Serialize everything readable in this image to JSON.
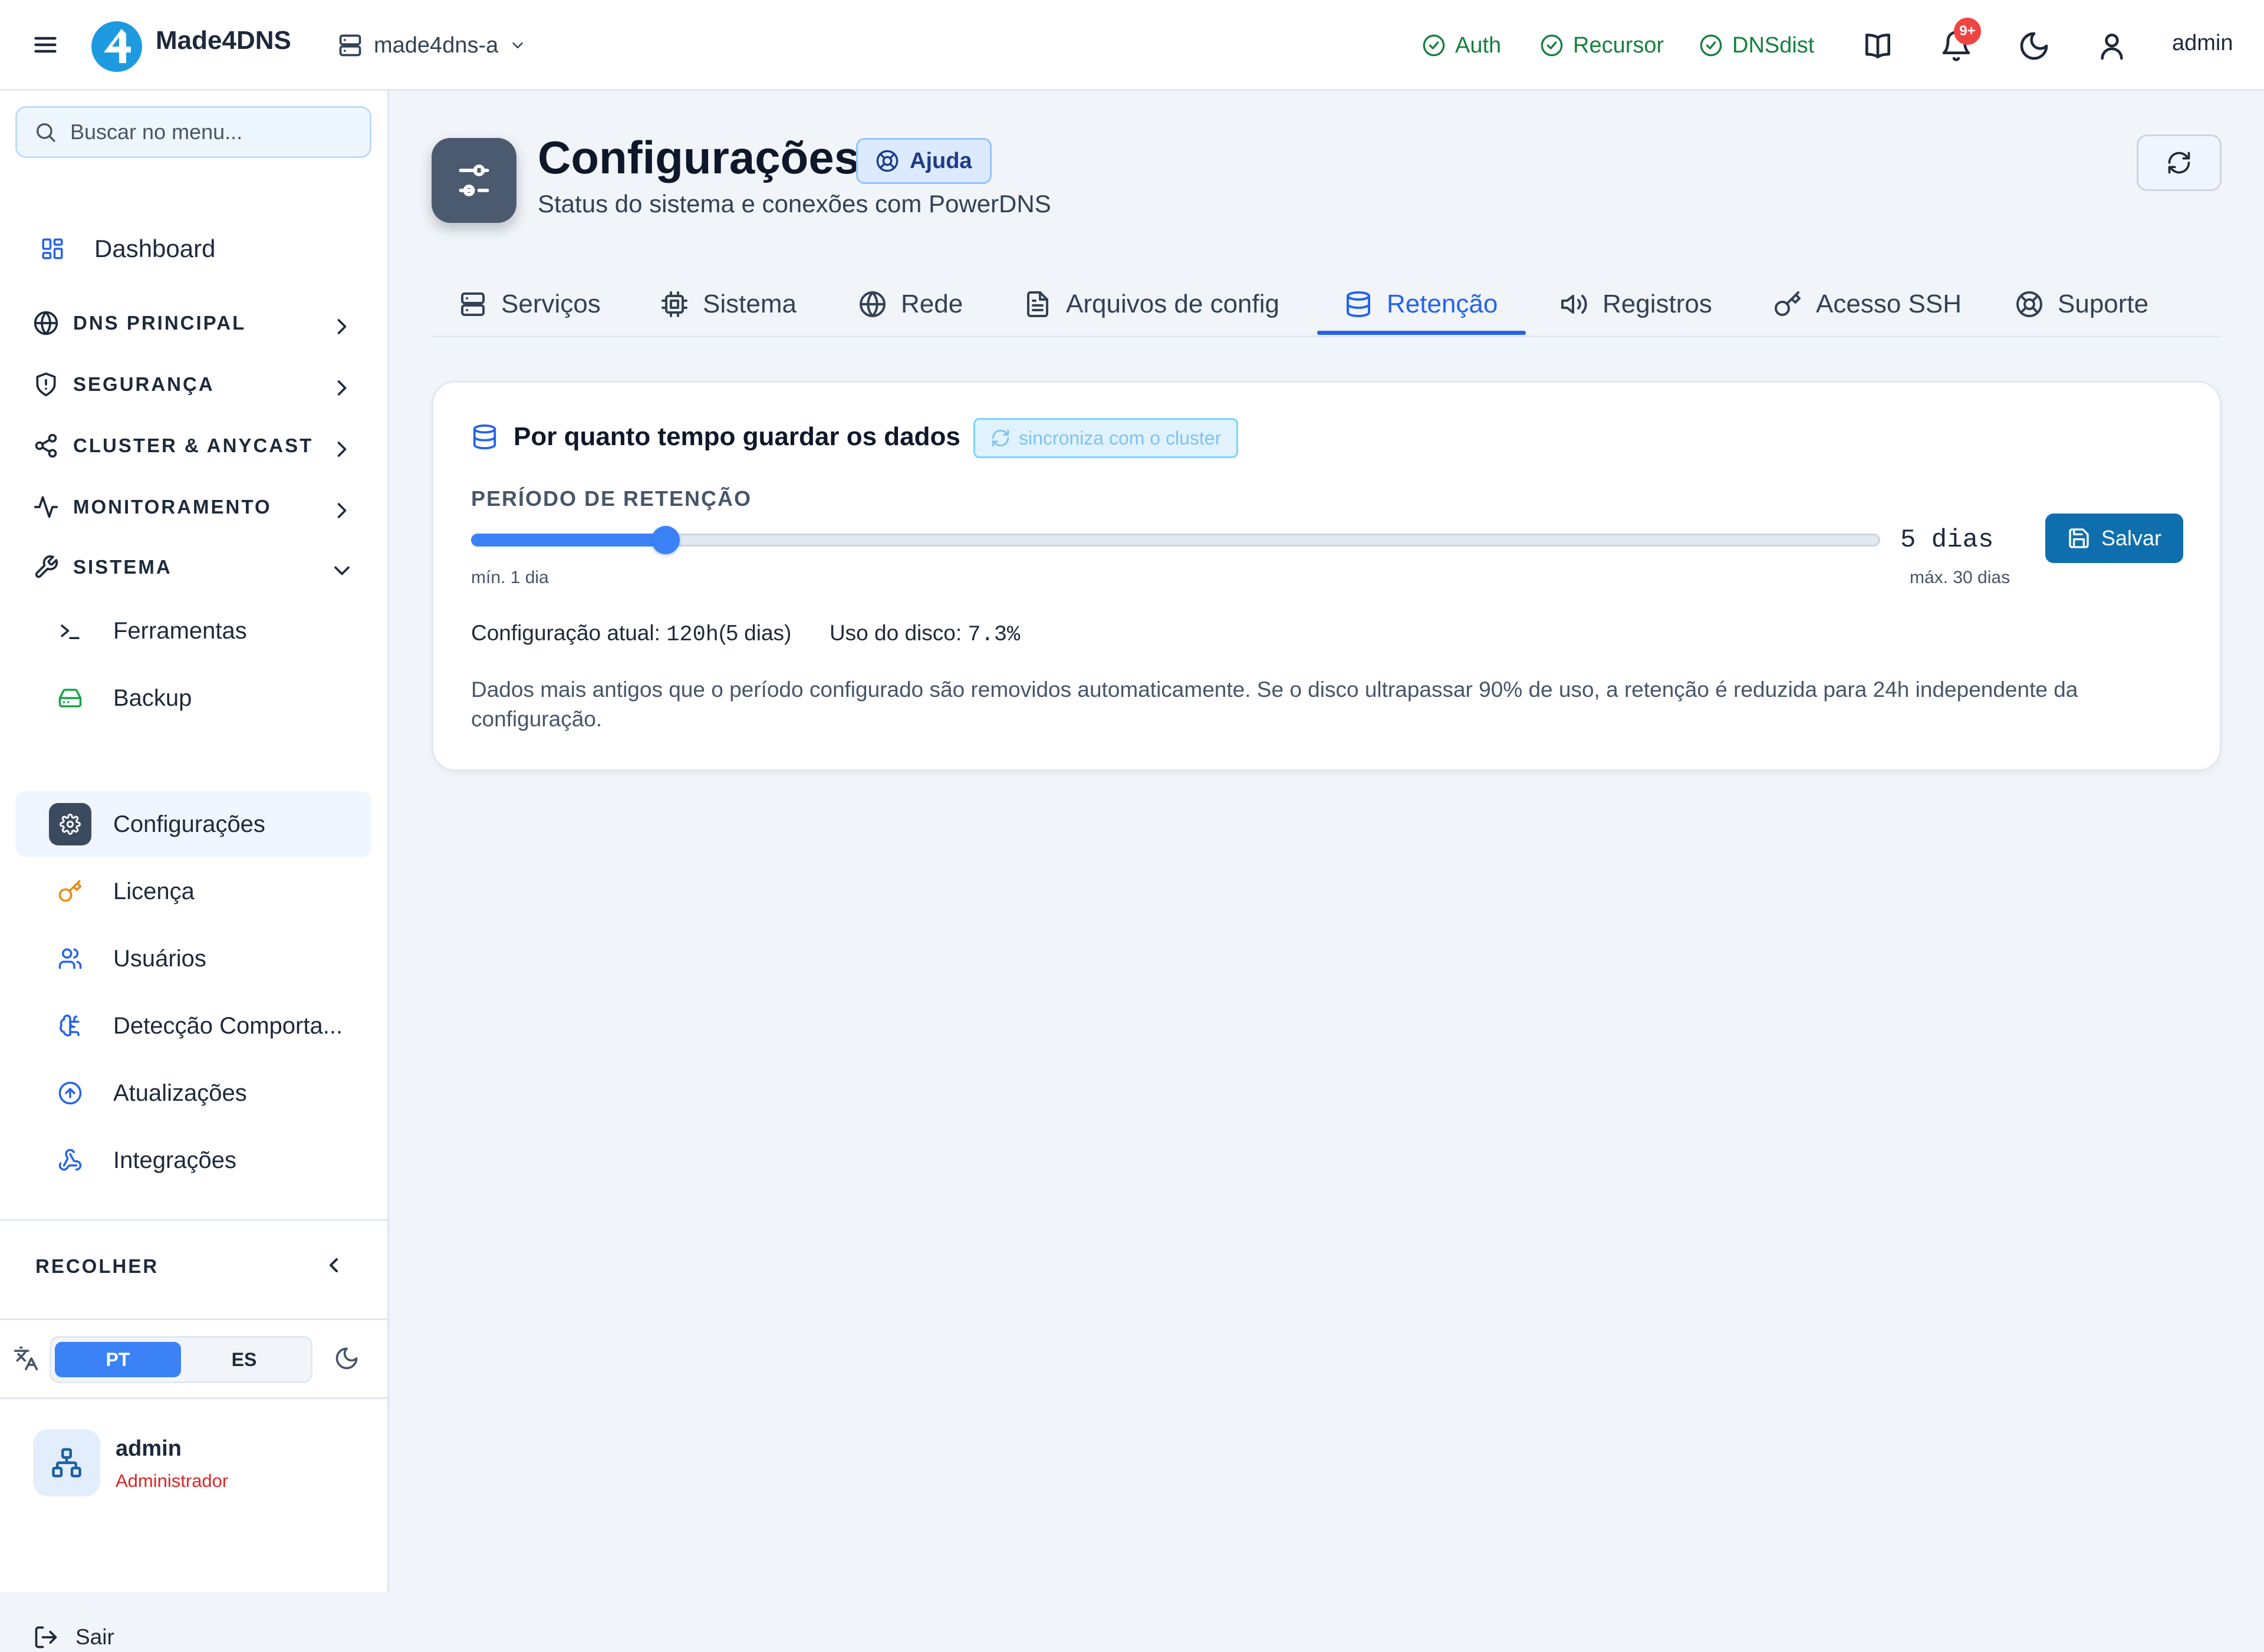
{
  "header": {
    "brand": "Made4DNS",
    "server": "made4dns-a",
    "services": [
      {
        "label": "Auth",
        "status": "ok"
      },
      {
        "label": "Recursor",
        "status": "ok"
      },
      {
        "label": "DNSdist",
        "status": "ok"
      }
    ],
    "notification_badge": "9+",
    "user": "admin",
    "icons": [
      "menu-icon",
      "logo",
      "server-icon",
      "check-circle-icon",
      "book-icon",
      "bell-icon",
      "moon-icon",
      "user-icon"
    ]
  },
  "sidebar": {
    "search_placeholder": "Buscar no menu...",
    "dashboard": "Dashboard",
    "sections": [
      {
        "label": "DNS PRINCIPAL",
        "icon": "globe-icon",
        "expanded": false
      },
      {
        "label": "SEGURANÇA",
        "icon": "shield-icon",
        "expanded": false
      },
      {
        "label": "CLUSTER & ANYCAST",
        "icon": "share-icon",
        "expanded": false
      },
      {
        "label": "MONITORAMENTO",
        "icon": "activity-icon",
        "expanded": false
      },
      {
        "label": "SISTEMA",
        "icon": "wrench-icon",
        "expanded": true
      }
    ],
    "sistema_items": [
      {
        "label": "Ferramentas",
        "icon": "terminal-icon"
      },
      {
        "label": "Backup",
        "icon": "hard-drive-icon"
      },
      {
        "label": "Configurações",
        "icon": "gear-icon",
        "active": true
      },
      {
        "label": "Licença",
        "icon": "key-icon"
      },
      {
        "label": "Usuários",
        "icon": "users-icon"
      },
      {
        "label": "Detecção Comporta...",
        "icon": "brain-icon"
      },
      {
        "label": "Atualizações",
        "icon": "arrow-up-circle-icon"
      },
      {
        "label": "Integrações",
        "icon": "webhook-icon"
      }
    ],
    "collapse_label": "RECOLHER",
    "languages": [
      "PT",
      "ES"
    ],
    "active_language": "PT",
    "user": {
      "name": "admin",
      "role": "Administrador"
    },
    "logout": "Sair"
  },
  "page": {
    "title": "Configurações",
    "help": "Ajuda",
    "subtitle": "Status do sistema e conexões com PowerDNS",
    "tabs": [
      {
        "label": "Serviços",
        "icon": "server-icon"
      },
      {
        "label": "Sistema",
        "icon": "cpu-icon"
      },
      {
        "label": "Rede",
        "icon": "globe-icon"
      },
      {
        "label": "Arquivos de config",
        "icon": "file-text-icon"
      },
      {
        "label": "Retenção",
        "icon": "database-icon",
        "active": true
      },
      {
        "label": "Registros",
        "icon": "megaphone-icon"
      },
      {
        "label": "Acesso SSH",
        "icon": "key-icon"
      },
      {
        "label": "Suporte",
        "icon": "life-buoy-icon"
      }
    ]
  },
  "retention": {
    "card_title": "Por quanto tempo guardar os dados",
    "sync_badge": "sincroniza com o cluster",
    "period_label": "PERÍODO DE RETENÇÃO",
    "min_days": 1,
    "max_days": 30,
    "value_days": 5,
    "value_text": "5 dias",
    "min_label": "mín. 1 dia",
    "max_label": "máx. 30 dias",
    "save": "Salvar",
    "current_label": "Configuração atual:",
    "current_value": "120h",
    "current_days": "(5 dias)",
    "disk_label": "Uso do disco:",
    "disk_value": "7.3%",
    "description": "Dados mais antigos que o período configurado são removidos automaticamente. Se o disco ultrapassar 90% de uso, a retenção é reduzida para 24h independente da configuração."
  },
  "colors": {
    "accent": "#2563eb",
    "ok": "#15803d",
    "badge": "#ef4444",
    "save": "#0f6fae",
    "role": "#dc2626"
  }
}
